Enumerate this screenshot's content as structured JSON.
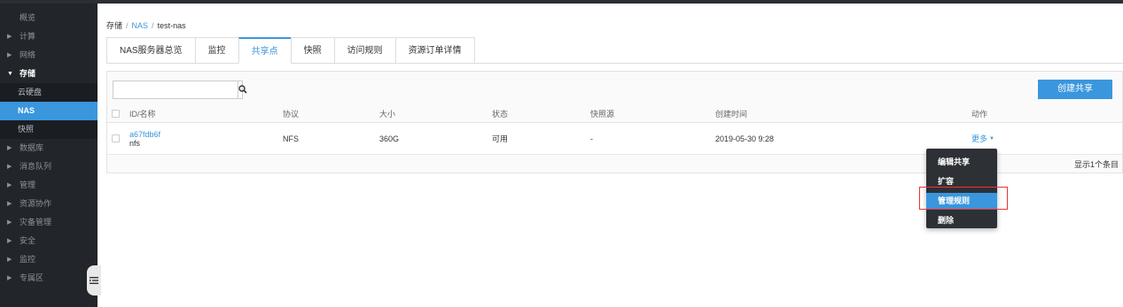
{
  "sidebar": {
    "items": [
      {
        "label": "概览",
        "type": "plain"
      },
      {
        "label": "计算",
        "type": "group"
      },
      {
        "label": "网络",
        "type": "group"
      },
      {
        "label": "存储",
        "type": "open"
      },
      {
        "label": "云硬盘",
        "type": "sub"
      },
      {
        "label": "NAS",
        "type": "active"
      },
      {
        "label": "快照",
        "type": "sub"
      },
      {
        "label": "数据库",
        "type": "group"
      },
      {
        "label": "消息队列",
        "type": "group"
      },
      {
        "label": "管理",
        "type": "group"
      },
      {
        "label": "资源协作",
        "type": "group"
      },
      {
        "label": "灾备管理",
        "type": "group"
      },
      {
        "label": "安全",
        "type": "group"
      },
      {
        "label": "监控",
        "type": "group"
      },
      {
        "label": "专属区",
        "type": "group"
      }
    ]
  },
  "breadcrumb": {
    "root": "存储",
    "parent": "NAS",
    "current": "test-nas",
    "sep": "/"
  },
  "tabs": [
    "NAS服务器总览",
    "监控",
    "共享点",
    "快照",
    "访问规则",
    "资源订单详情"
  ],
  "active_tab": 2,
  "search": {
    "value": "",
    "placeholder": ""
  },
  "create_label": "创建共享",
  "table": {
    "headers": {
      "id": "ID/名称",
      "protocol": "协议",
      "size": "大小",
      "status": "状态",
      "snapshot": "快照源",
      "created": "创建时间",
      "action": "动作"
    },
    "rows": [
      {
        "id": "a67fdb6f",
        "name": "nfs",
        "protocol": "NFS",
        "size": "360G",
        "status": "可用",
        "snapshot": "-",
        "created": "2019-05-30 9:28",
        "action": "更多"
      }
    ],
    "footer": "显示1个条目"
  },
  "dropdown": [
    "编辑共享",
    "扩容",
    "管理规则",
    "删除"
  ],
  "dropdown_highlighted": 2,
  "colors": {
    "accent": "#3a96dd",
    "sidebar_bg": "#22262b",
    "dropdown_bg": "#2d3035",
    "highlight_border": "#ee3333"
  }
}
